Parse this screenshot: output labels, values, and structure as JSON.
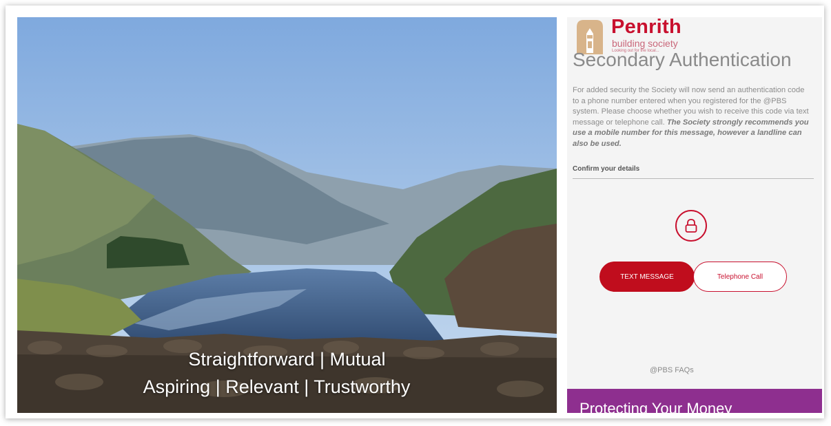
{
  "hero": {
    "tagline_line1": "Straightforward | Mutual",
    "tagline_line2": "Aspiring | Relevant | Trustworthy"
  },
  "logo": {
    "name": "Penrith",
    "subtitle": "building society",
    "tagline": "Looking out for the local..."
  },
  "auth": {
    "title": "Secondary Authentication",
    "intro_plain": "For added security the Society will now send an authentication code to a phone number entered when you registered for the @PBS system.  Please choose whether you wish to receive this code via text message or telephone call.",
    "intro_emphasis": "The Society strongly recommends you use a mobile number for this message, however a landline can also be used.",
    "confirm_label": "Confirm your details",
    "lock_icon": "lock-icon",
    "text_message_button": "TEXT MESSAGE",
    "telephone_call_button": "Telephone Call",
    "faq_link": "@PBS FAQs",
    "banner_text": "Protecting Your Money"
  },
  "colors": {
    "brand_red": "#c8102e",
    "button_red": "#c00d1d",
    "banner_purple": "#8e2f8f",
    "panel_bg": "#f4f4f4"
  }
}
